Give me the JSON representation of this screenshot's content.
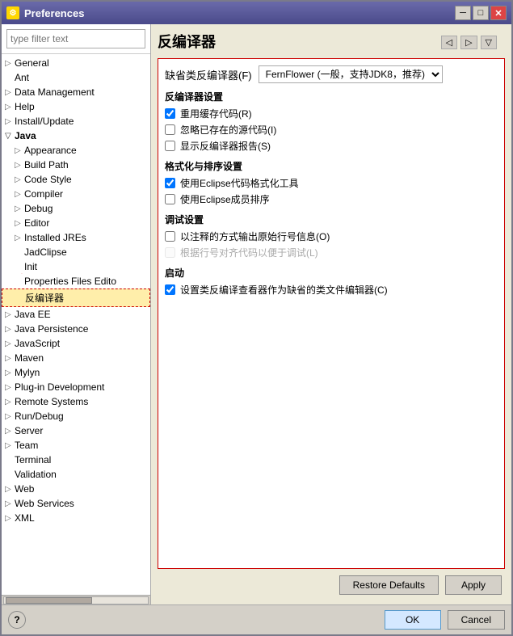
{
  "window": {
    "title": "Preferences",
    "icon": "⚙"
  },
  "filter": {
    "placeholder": "type filter text"
  },
  "tree": {
    "items": [
      {
        "id": "general",
        "label": "General",
        "level": 0,
        "has_arrow": true,
        "open": false
      },
      {
        "id": "ant",
        "label": "Ant",
        "level": 0,
        "has_arrow": false,
        "open": false
      },
      {
        "id": "data-mgmt",
        "label": "Data Management",
        "level": 0,
        "has_arrow": true,
        "open": false
      },
      {
        "id": "help",
        "label": "Help",
        "level": 0,
        "has_arrow": true,
        "open": false
      },
      {
        "id": "install-update",
        "label": "Install/Update",
        "level": 0,
        "has_arrow": true,
        "open": false
      },
      {
        "id": "java",
        "label": "Java",
        "level": 0,
        "has_arrow": true,
        "open": true
      },
      {
        "id": "appearance",
        "label": "Appearance",
        "level": 1,
        "has_arrow": true,
        "open": false
      },
      {
        "id": "build-path",
        "label": "Build Path",
        "level": 1,
        "has_arrow": true,
        "open": false
      },
      {
        "id": "code-style",
        "label": "Code Style",
        "level": 1,
        "has_arrow": true,
        "open": false
      },
      {
        "id": "compiler",
        "label": "Compiler",
        "level": 1,
        "has_arrow": true,
        "open": false
      },
      {
        "id": "debug",
        "label": "Debug",
        "level": 1,
        "has_arrow": true,
        "open": false
      },
      {
        "id": "editor",
        "label": "Editor",
        "level": 1,
        "has_arrow": true,
        "open": false
      },
      {
        "id": "installed-jres",
        "label": "Installed JREs",
        "level": 1,
        "has_arrow": true,
        "open": false
      },
      {
        "id": "jadclipse",
        "label": "JadClipse",
        "level": 1,
        "has_arrow": false,
        "open": false
      },
      {
        "id": "init",
        "label": "Init",
        "level": 1,
        "has_arrow": false,
        "open": false
      },
      {
        "id": "properties",
        "label": "Properties Files Edito",
        "level": 1,
        "has_arrow": false,
        "open": false
      },
      {
        "id": "decompiler",
        "label": "反编译器",
        "level": 1,
        "has_arrow": false,
        "open": false,
        "selected": true
      },
      {
        "id": "java-ee",
        "label": "Java EE",
        "level": 0,
        "has_arrow": true,
        "open": false
      },
      {
        "id": "java-persistence",
        "label": "Java Persistence",
        "level": 0,
        "has_arrow": true,
        "open": false
      },
      {
        "id": "javascript",
        "label": "JavaScript",
        "level": 0,
        "has_arrow": true,
        "open": false
      },
      {
        "id": "maven",
        "label": "Maven",
        "level": 0,
        "has_arrow": true,
        "open": false
      },
      {
        "id": "mylyn",
        "label": "Mylyn",
        "level": 0,
        "has_arrow": true,
        "open": false
      },
      {
        "id": "plugin-dev",
        "label": "Plug-in Development",
        "level": 0,
        "has_arrow": true,
        "open": false
      },
      {
        "id": "remote-systems",
        "label": "Remote Systems",
        "level": 0,
        "has_arrow": true,
        "open": false
      },
      {
        "id": "run-debug",
        "label": "Run/Debug",
        "level": 0,
        "has_arrow": true,
        "open": false
      },
      {
        "id": "server",
        "label": "Server",
        "level": 0,
        "has_arrow": true,
        "open": false
      },
      {
        "id": "team",
        "label": "Team",
        "level": 0,
        "has_arrow": true,
        "open": false
      },
      {
        "id": "terminal",
        "label": "Terminal",
        "level": 0,
        "has_arrow": false,
        "open": false
      },
      {
        "id": "validation",
        "label": "Validation",
        "level": 0,
        "has_arrow": false,
        "open": false
      },
      {
        "id": "web",
        "label": "Web",
        "level": 0,
        "has_arrow": true,
        "open": false
      },
      {
        "id": "web-services",
        "label": "Web Services",
        "level": 0,
        "has_arrow": true,
        "open": false
      },
      {
        "id": "xml",
        "label": "XML",
        "level": 0,
        "has_arrow": true,
        "open": false
      }
    ]
  },
  "right_panel": {
    "title": "反编译器",
    "decompiler_label": "缺省类反编译器(F)",
    "decompiler_value": "FernFlower (一般，支持JDK8，推荐)",
    "sections": [
      {
        "title": "反编译器设置",
        "items": [
          {
            "label": "重用缓存代码(R)",
            "checked": true,
            "disabled": false
          },
          {
            "label": "忽略已存在的源代码(I)",
            "checked": false,
            "disabled": false
          },
          {
            "label": "显示反编译器报告(S)",
            "checked": false,
            "disabled": false
          }
        ]
      },
      {
        "title": "格式化与排序设置",
        "items": [
          {
            "label": "使用Eclipse代码格式化工具",
            "checked": true,
            "disabled": false
          },
          {
            "label": "使用Eclipse成员排序",
            "checked": false,
            "disabled": false
          }
        ]
      },
      {
        "title": "调试设置",
        "items": [
          {
            "label": "以注释的方式输出原始行号信息(O)",
            "checked": false,
            "disabled": false
          },
          {
            "label": "根据行号对齐代码以便于调试(L)",
            "checked": false,
            "disabled": true
          }
        ]
      },
      {
        "title": "启动",
        "items": [
          {
            "label": "设置类反编译查看器作为缺省的类文件编辑器(C)",
            "checked": true,
            "disabled": false
          }
        ]
      }
    ],
    "restore_defaults": "Restore Defaults",
    "apply": "Apply"
  },
  "footer": {
    "ok": "OK",
    "cancel": "Cancel"
  }
}
